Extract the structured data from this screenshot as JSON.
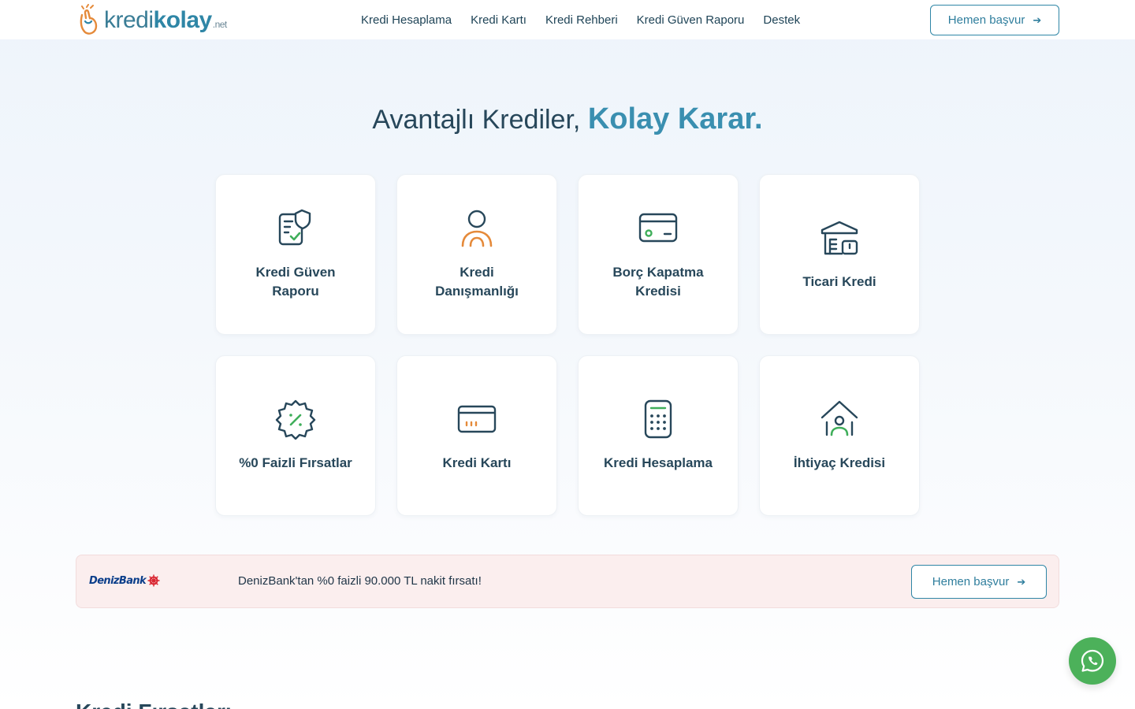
{
  "logo": {
    "kredi": "kredi",
    "kolay": "kolay",
    "net": ".net"
  },
  "nav": {
    "items": [
      "Kredi Hesaplama",
      "Kredi Kartı",
      "Kredi Rehberi",
      "Kredi Güven Raporu",
      "Destek"
    ]
  },
  "header_cta": {
    "label": "Hemen başvur",
    "icon": "arrow-right-icon"
  },
  "hero": {
    "title_plain": "Avantajlı Krediler, ",
    "title_accent": "Kolay Karar."
  },
  "cards": [
    {
      "label": "Kredi Güven Raporu",
      "icon": "credit-report-shield-icon"
    },
    {
      "label": "Kredi Danışmanlığı",
      "icon": "person-consultant-icon"
    },
    {
      "label": "Borç Kapatma Kredisi",
      "icon": "wallet-card-icon"
    },
    {
      "label": "Ticari Kredi",
      "icon": "commercial-building-icon"
    },
    {
      "label": "%0 Faizli Fırsatlar",
      "icon": "percent-badge-icon"
    },
    {
      "label": "Kredi Kartı",
      "icon": "credit-card-icon"
    },
    {
      "label": "Kredi Hesaplama",
      "icon": "calculator-icon"
    },
    {
      "label": "İhtiyaç Kredisi",
      "icon": "home-person-icon"
    }
  ],
  "promo": {
    "bank": "DenizBank",
    "text": "DenizBank'tan %0 faizli 90.000 TL nakit fırsatı!",
    "cta": "Hemen başvur"
  },
  "section_peek": "Kredi Fırsatları",
  "whatsapp": {
    "icon": "whatsapp-icon"
  },
  "colors": {
    "accent": "#2f86a6",
    "orange": "#e58a3a",
    "green": "#3fae5a",
    "promo_bg": "#fbeeee"
  }
}
